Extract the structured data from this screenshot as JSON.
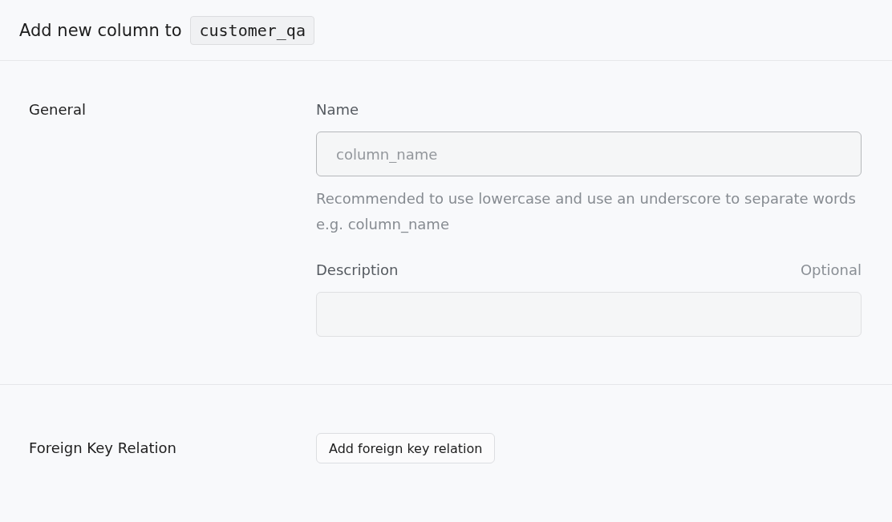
{
  "header": {
    "title": "Add new column to",
    "table_name": "customer_qa"
  },
  "sections": [
    {
      "kind": "fields",
      "label": "General",
      "fields": [
        {
          "label": "Name",
          "placeholder": "column_name",
          "hint": "Recommended to use lowercase and use an underscore to separate words e.g. column_name"
        },
        {
          "label": "Description",
          "optional": "Optional"
        }
      ]
    },
    {
      "kind": "action",
      "label": "Foreign Key Relation",
      "button": "Add foreign key relation"
    }
  ]
}
